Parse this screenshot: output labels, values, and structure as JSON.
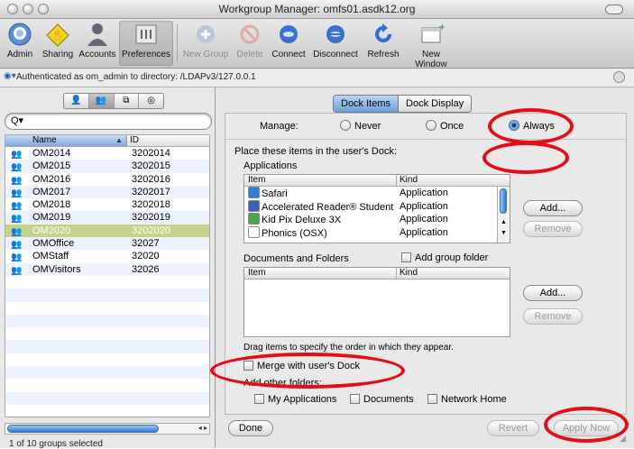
{
  "window": {
    "title": "Workgroup Manager: omfs01.asdk12.org"
  },
  "toolbar": {
    "items": [
      {
        "label": "Admin",
        "icon": "admin-icon"
      },
      {
        "label": "Sharing",
        "icon": "sharing-icon"
      },
      {
        "label": "Accounts",
        "icon": "accounts-icon"
      },
      {
        "label": "Preferences",
        "icon": "preferences-icon"
      },
      {
        "label": "New Group",
        "icon": "new-group-icon"
      },
      {
        "label": "Delete",
        "icon": "delete-icon"
      },
      {
        "label": "Connect",
        "icon": "connect-icon"
      },
      {
        "label": "Disconnect",
        "icon": "disconnect-icon"
      },
      {
        "label": "Refresh",
        "icon": "refresh-icon"
      },
      {
        "label": "New Window",
        "icon": "new-window-icon"
      }
    ]
  },
  "auth": {
    "text": "Authenticated as om_admin to directory: /LDAPv3/127.0.0.1"
  },
  "left": {
    "columns": {
      "name": "Name",
      "id": "ID"
    },
    "groups": [
      {
        "name": "OM2014",
        "id": "3202014"
      },
      {
        "name": "OM2015",
        "id": "3202015"
      },
      {
        "name": "OM2016",
        "id": "3202016"
      },
      {
        "name": "OM2017",
        "id": "3202017"
      },
      {
        "name": "OM2018",
        "id": "3202018"
      },
      {
        "name": "OM2019",
        "id": "3202019"
      },
      {
        "name": "OM2020",
        "id": "3202020"
      },
      {
        "name": "OMOffice",
        "id": "32027"
      },
      {
        "name": "OMStaff",
        "id": "32020"
      },
      {
        "name": "OMVisitors",
        "id": "32026"
      }
    ],
    "selected_index": 6,
    "status": "1 of 10 groups selected"
  },
  "right": {
    "tabs": [
      "Dock Items",
      "Dock Display"
    ],
    "manage": {
      "label": "Manage:",
      "never": "Never",
      "once": "Once",
      "always": "Always"
    },
    "place_label": "Place these items in the user's Dock:",
    "apps_label": "Applications",
    "apps_columns": {
      "item": "Item",
      "kind": "Kind"
    },
    "apps": [
      {
        "item": "Safari",
        "kind": "Application",
        "color": "#2f7fd6"
      },
      {
        "item": "Accelerated Reader® Student",
        "kind": "Application",
        "color": "#3b5fb5"
      },
      {
        "item": "Kid Pix Deluxe 3X",
        "kind": "Application",
        "color": "#4aa548"
      },
      {
        "item": "Phonics (OSX)",
        "kind": "Application",
        "color": "#ffffff"
      }
    ],
    "docs_label": "Documents and Folders",
    "add_group_folder": "Add group folder",
    "docs_columns": {
      "item": "Item",
      "kind": "Kind"
    },
    "add": "Add...",
    "remove": "Remove",
    "drag_hint": "Drag items to specify the order in which they appear.",
    "merge": "Merge with user's Dock",
    "add_other_label": "Add other folders:",
    "folders": [
      "My Applications",
      "Documents",
      "Network Home"
    ],
    "done": "Done",
    "revert": "Revert",
    "apply": "Apply Now"
  },
  "colors": {
    "highlight": "#e40d18",
    "selected_row": "#c6d28a"
  }
}
